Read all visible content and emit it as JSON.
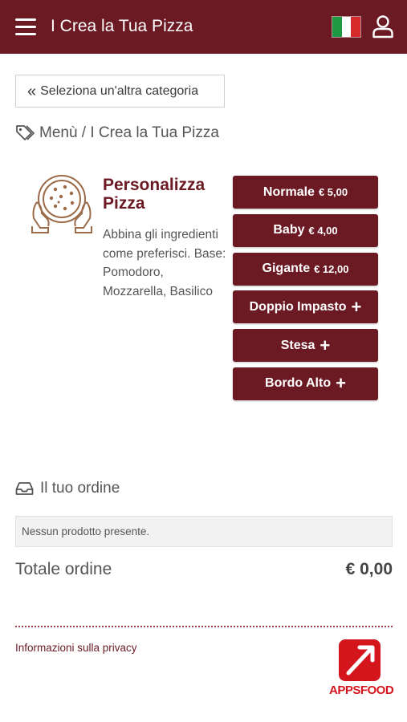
{
  "header": {
    "title": "I Crea la Tua Pizza",
    "menu_icon": "hamburger-icon",
    "flag": "italy-flag",
    "user_icon": "user-icon",
    "bg_color": "#6b1a24"
  },
  "back_button": {
    "label": "Seleziona un'altra categoria",
    "icon": "double-chevron-left-icon"
  },
  "breadcrumb": {
    "text": "Menù / I Crea la Tua Pizza",
    "icon": "tag-icon"
  },
  "product": {
    "title": "Personalizza Pizza",
    "description": "Abbina gli ingredienti come preferisci. Base: Pomodoro, Mozzarella, Basilico",
    "image_icon": "pizza-hands-icon"
  },
  "options": [
    {
      "label": "Normale",
      "price": "€ 5,00"
    },
    {
      "label": "Baby",
      "price": "€ 4,00"
    },
    {
      "label": "Gigante",
      "price": "€ 12,00"
    },
    {
      "label": "Doppio Impasto",
      "plus": "+"
    },
    {
      "label": "Stesa",
      "plus": "+"
    },
    {
      "label": "Bordo Alto",
      "plus": "+"
    }
  ],
  "order": {
    "heading": "Il tuo ordine",
    "icon": "inbox-icon",
    "empty_text": "Nessun prodotto presente.",
    "total_label": "Totale ordine",
    "total_value": "€ 0,00"
  },
  "footer": {
    "privacy_label": "Informazioni sulla privacy",
    "logo_text": "APPSFOOD",
    "logo_color": "#d4151c"
  }
}
